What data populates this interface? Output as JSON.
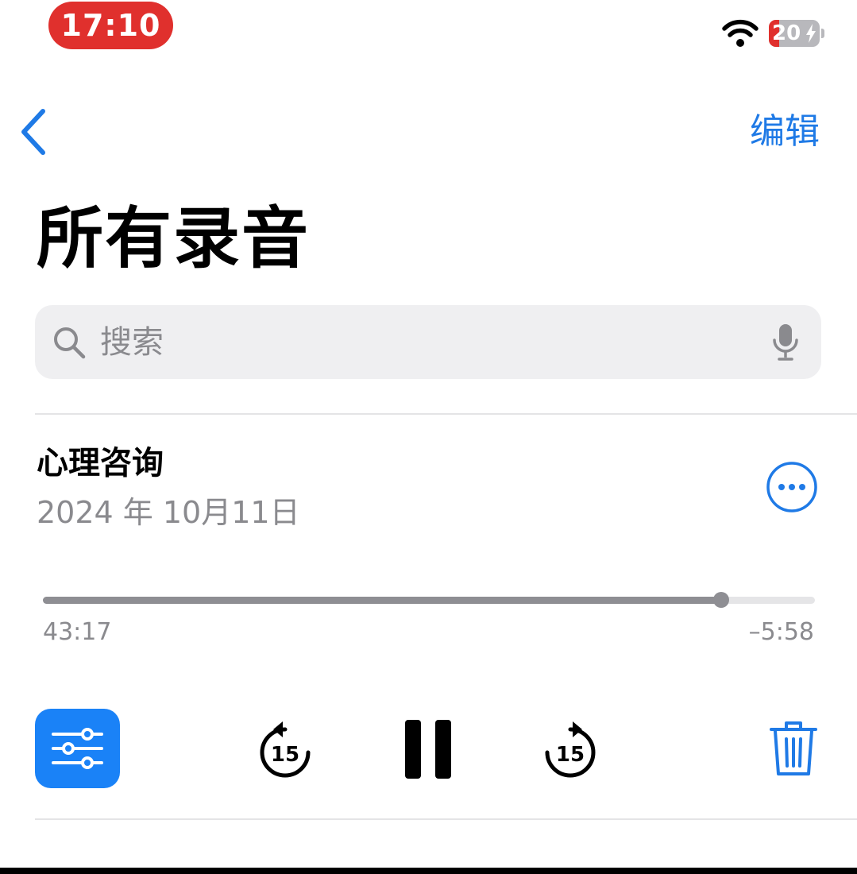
{
  "status_bar": {
    "time": "17:10",
    "battery_level": "20",
    "battery_fraction": 0.2,
    "colors": {
      "time_pill": "#e0302d",
      "battery_low": "#e0302d"
    }
  },
  "nav": {
    "back_icon": "chevron-left-icon",
    "edit_label": "编辑",
    "title": "所有录音"
  },
  "search": {
    "placeholder": "搜索",
    "value": "",
    "left_icon": "magnifier-icon",
    "right_icon": "microphone-icon"
  },
  "recording": {
    "title": "心理咨询",
    "date": "2024 年 10月11日",
    "elapsed": "43:17",
    "remaining": "–5:58",
    "progress_fraction": 0.879,
    "more_icon": "ellipsis-circle-icon"
  },
  "controls": {
    "filters_icon": "sliders-icon",
    "skip_back_icon": "skip-back-15-icon",
    "skip_back_seconds": "15",
    "play_state_icon": "pause-icon",
    "skip_forward_icon": "skip-forward-15-icon",
    "skip_forward_seconds": "15",
    "delete_icon": "trash-icon"
  },
  "colors": {
    "accent": "#1f7ae6",
    "filters_button": "#1a82f7",
    "secondary_text": "#8a8a8e",
    "search_bg": "#efeff1"
  }
}
